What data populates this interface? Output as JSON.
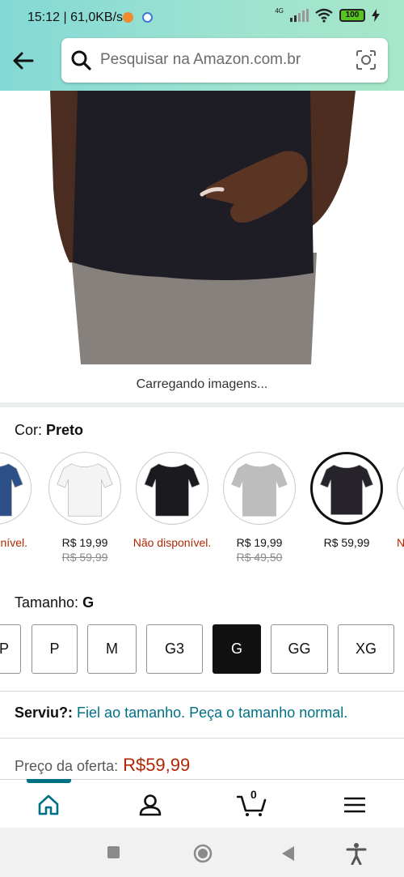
{
  "status": {
    "time": "15:12 | 61,0KB/s",
    "network": "4G",
    "battery": "100"
  },
  "search": {
    "placeholder": "Pesquisar na Amazon.com.br"
  },
  "gallery": {
    "loading_text": "Carregando imagens..."
  },
  "color": {
    "label": "Cor:",
    "selected": "Preto",
    "options": [
      {
        "price": "ponível.",
        "old_price": "",
        "available": false,
        "shirt": "#2b4f86",
        "selected": false
      },
      {
        "price": "R$ 19,99",
        "old_price": "R$ 59,99",
        "available": true,
        "shirt": "#f4f4f4",
        "selected": false
      },
      {
        "price": "Não disponível.",
        "old_price": "",
        "available": false,
        "shirt": "#1b1b1f",
        "selected": false
      },
      {
        "price": "R$ 19,99",
        "old_price": "R$ 49,50",
        "available": true,
        "shirt": "#bdbdbd",
        "selected": false
      },
      {
        "price": "R$ 59,99",
        "old_price": "",
        "available": true,
        "shirt": "#26232b",
        "selected": true
      },
      {
        "price": "N",
        "old_price": "",
        "available": false,
        "shirt": "#2e3a5e",
        "selected": false
      }
    ]
  },
  "size": {
    "label": "Tamanho:",
    "selected": "G",
    "options": [
      "P",
      "P",
      "M",
      "G3",
      "G",
      "GG",
      "XG"
    ]
  },
  "fit": {
    "label": "Serviu?:",
    "text": "Fiel ao tamanho. Peça o tamanho normal."
  },
  "offer": {
    "label": "Preço da oferta:",
    "value": "R$59,99"
  },
  "cart": {
    "count": "0"
  },
  "colors": {
    "link": "#007185",
    "price": "#b12704",
    "accent": "#007185"
  }
}
